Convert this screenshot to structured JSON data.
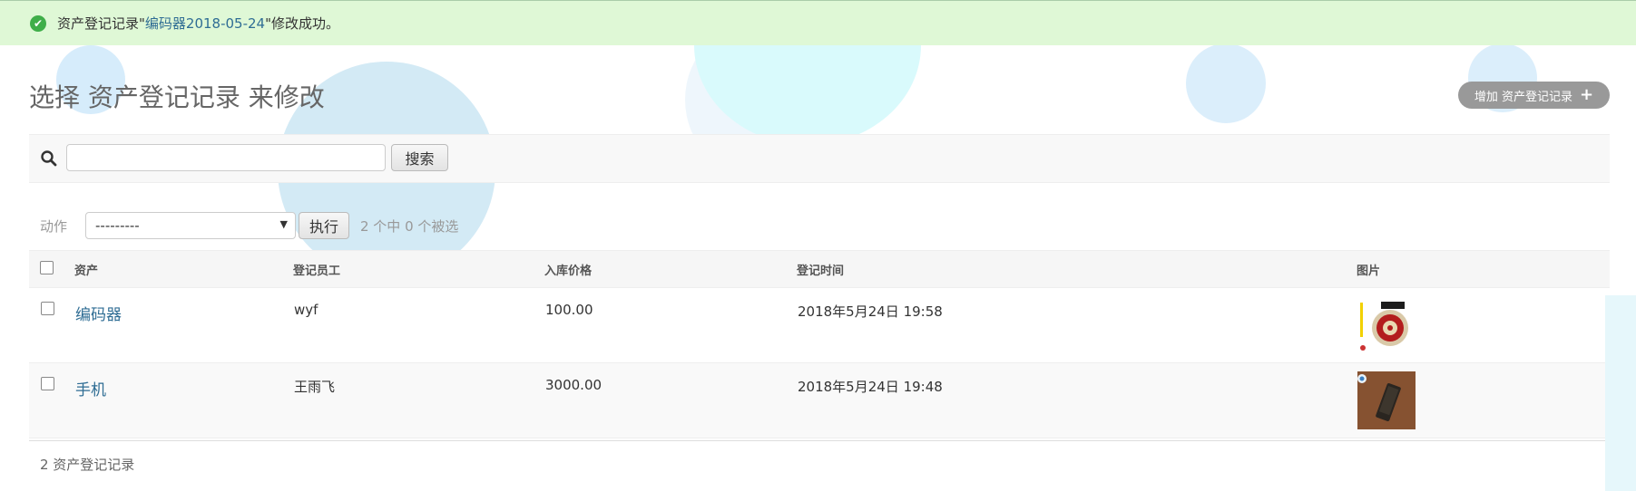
{
  "message": {
    "prefix": "资产登记记录\"",
    "link": "编码器2018-05-24",
    "suffix": "\"修改成功。"
  },
  "page": {
    "title": "选择 资产登记记录 来修改",
    "add_button": "增加 资产登记记录"
  },
  "search": {
    "placeholder": "",
    "button": "搜索"
  },
  "actions": {
    "label": "动作",
    "select_value": "---------",
    "run_button": "执行",
    "selection_count": "2 个中 0 个被选"
  },
  "table": {
    "headers": [
      "资产",
      "登记员工",
      "入库价格",
      "登记时间",
      "图片"
    ],
    "rows": [
      {
        "asset": "编码器",
        "staff": "wyf",
        "price": "100.00",
        "time": "2018年5月24日 19:58"
      },
      {
        "asset": "手机",
        "staff": "王雨飞",
        "price": "3000.00",
        "time": "2018年5月24日 19:48"
      }
    ]
  },
  "footer": {
    "count": "2 资产登记记录"
  },
  "colors": {
    "success_bg": "#dff8d6",
    "link": "#2f6d94",
    "add_button_bg": "#999999"
  }
}
